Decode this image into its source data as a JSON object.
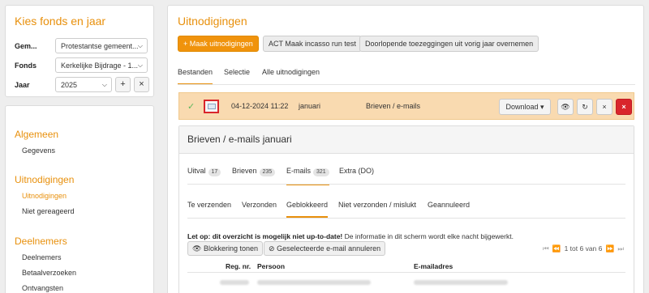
{
  "left_panel": {
    "title": "Kies fonds en jaar",
    "rows": [
      {
        "label": "Gem...",
        "value": "Protestantse gemeent..."
      },
      {
        "label": "Fonds",
        "value": "Kerkelijke Bijdrage - 1..."
      },
      {
        "label": "Jaar",
        "value": "2025"
      }
    ],
    "add_label": "+",
    "clear_label": "×"
  },
  "nav": {
    "sections": [
      {
        "title": "Algemeen",
        "items": [
          "Gegevens"
        ]
      },
      {
        "title": "Uitnodigingen",
        "items": [
          "Uitnodigingen",
          "Niet gereageerd"
        ]
      },
      {
        "title": "Deelnemers",
        "items": [
          "Deelnemers",
          "Betaalverzoeken",
          "Ontvangsten"
        ]
      }
    ],
    "active_item": "Uitnodigingen"
  },
  "main": {
    "title": "Uitnodigingen",
    "buttons": {
      "make": "+ Maak uitnodigingen",
      "act": "ACT Maak incasso run test",
      "ongoing": "Doorlopende toezeggingen uit vorig jaar overnemen"
    },
    "tabs": [
      "Bestanden",
      "Selectie",
      "Alle uitnodigingen"
    ],
    "active_tab": "Bestanden",
    "file_row": {
      "date": "04-12-2024 11:22",
      "month": "januari",
      "type": "Brieven / e-mails",
      "download_label": "Download ▾",
      "view_icon": "eye-icon",
      "refresh_icon": "refresh-icon",
      "clear_label": "×",
      "delete_label": "×"
    },
    "sub_panel": {
      "title": "Brieven / e-mails januari",
      "tabs": [
        {
          "label": "Uitval",
          "count": "17"
        },
        {
          "label": "Brieven",
          "count": "235"
        },
        {
          "label": "E-mails",
          "count": "321"
        },
        {
          "label": "Extra (DO)",
          "count": ""
        }
      ],
      "active_tab": "E-mails",
      "subtabs": [
        "Te verzenden",
        "Verzonden",
        "Geblokkeerd",
        "Niet verzonden / mislukt",
        "Geannuleerd"
      ],
      "active_subtab": "Geblokkeerd",
      "notice_bold": "Let op: dit overzicht is mogelijk niet up-to-date!",
      "notice_rest": " De informatie in dit scherm wordt elke nacht bijgewerkt.",
      "btn_show_block": "Blokkering tonen",
      "btn_cancel_email": "Geselecteerde e-mail annuleren",
      "pager_text": "1 tot 6 van 6",
      "columns": [
        "Reg. nr.",
        "Persoon",
        "E-mailadres"
      ]
    }
  },
  "colors": {
    "accent": "#e8900c",
    "highlight_row": "#f9dab0",
    "danger": "#d9262c",
    "success": "#5cb85c"
  }
}
